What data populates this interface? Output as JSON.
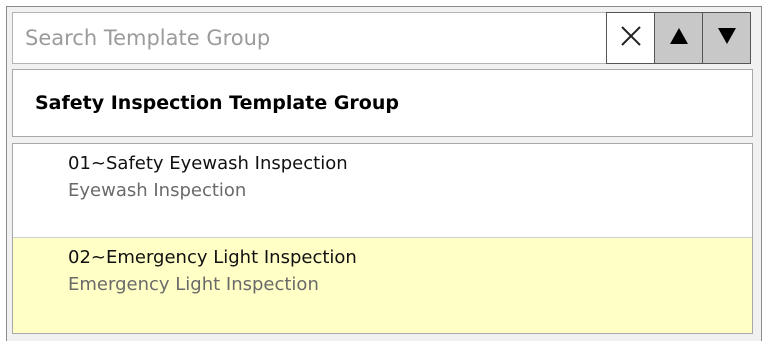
{
  "search": {
    "placeholder": "Search Template Group",
    "value": ""
  },
  "buttons": {
    "clear_icon": "close-icon",
    "up_icon": "triangle-up-icon",
    "down_icon": "triangle-down-icon"
  },
  "group": {
    "title": "Safety Inspection Template Group"
  },
  "items": [
    {
      "title": "01~Safety Eyewash Inspection",
      "subtitle": "Eyewash Inspection",
      "selected": false
    },
    {
      "title": "02~Emergency Light Inspection",
      "subtitle": "Emergency Light Inspection",
      "selected": true
    }
  ],
  "colors": {
    "selected_row": "#ffffc6",
    "nav_button": "#c8c8c8",
    "panel_background": "#f1f1f1"
  }
}
